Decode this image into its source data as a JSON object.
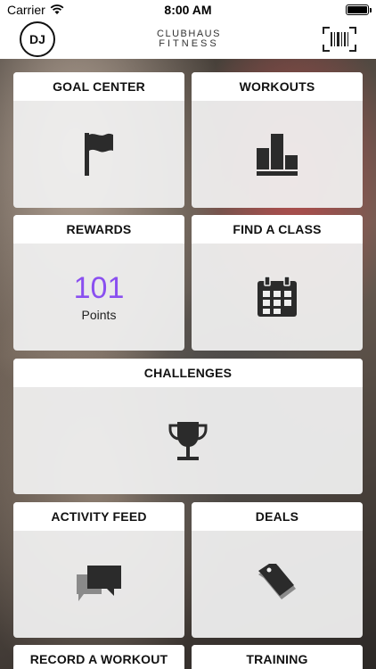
{
  "status_bar": {
    "carrier": "Carrier",
    "time": "8:00 AM"
  },
  "nav": {
    "avatar_initials": "DJ",
    "brand_line1": "CLUBHAUS",
    "brand_line2": "FITNESS"
  },
  "tiles": {
    "goal_center": "GOAL CENTER",
    "workouts": "WORKOUTS",
    "rewards": "REWARDS",
    "rewards_points": "101",
    "rewards_points_label": "Points",
    "find_a_class": "FIND A CLASS",
    "challenges": "CHALLENGES",
    "activity_feed": "ACTIVITY FEED",
    "deals": "DEALS",
    "record_a_workout": "RECORD A WORKOUT",
    "training": "TRAINING"
  },
  "colors": {
    "accent_points": "#8a4ff0",
    "icon": "#2b2b2b"
  }
}
